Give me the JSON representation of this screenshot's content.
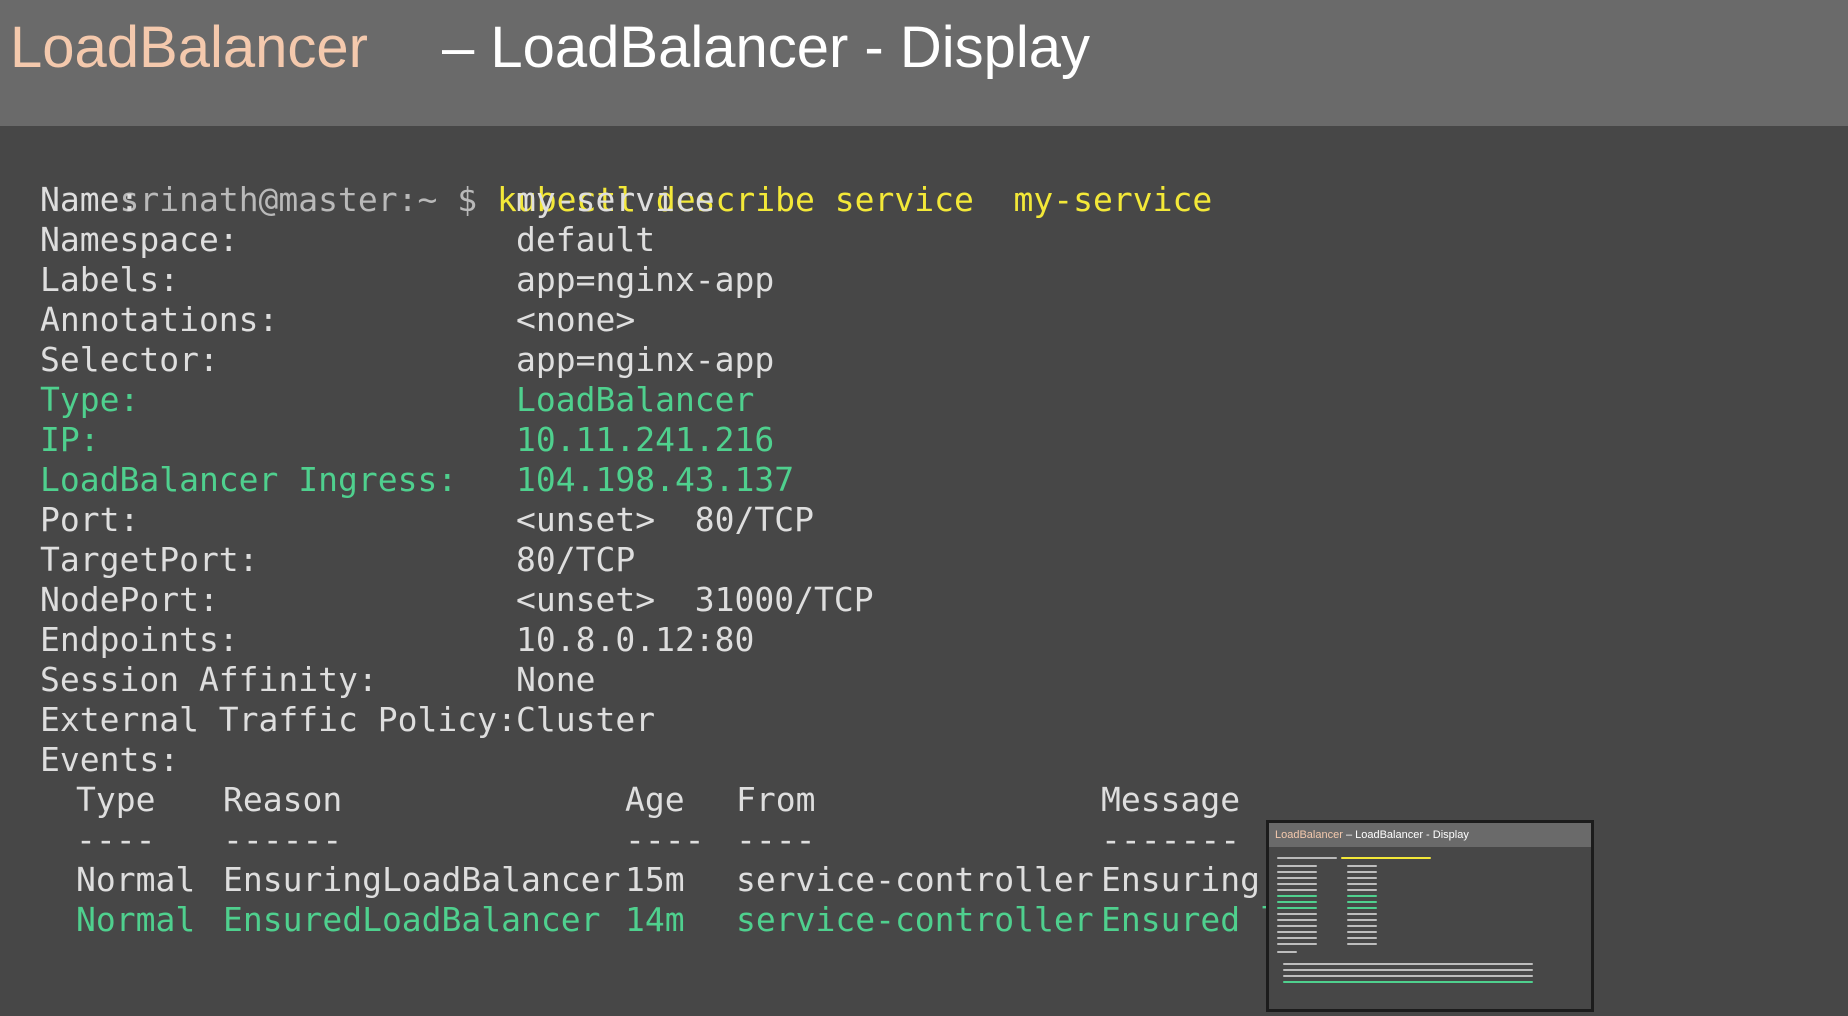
{
  "title": {
    "left": "LoadBalancer",
    "right": "– LoadBalancer - Display"
  },
  "terminal": {
    "prompt": "srinath@master:~ $",
    "command": "kubectl describe service  my-service",
    "fields": [
      {
        "key": "Name:",
        "value": "my-service",
        "highlight": false
      },
      {
        "key": "Namespace:",
        "value": "default",
        "highlight": false
      },
      {
        "key": "Labels:",
        "value": "app=nginx-app",
        "highlight": false
      },
      {
        "key": "Annotations:",
        "value": "<none>",
        "highlight": false
      },
      {
        "key": "Selector:",
        "value": "app=nginx-app",
        "highlight": false
      },
      {
        "key": "Type:",
        "value": "LoadBalancer",
        "highlight": true
      },
      {
        "key": "IP:",
        "value": "10.11.241.216",
        "highlight": true
      },
      {
        "key": "LoadBalancer Ingress:",
        "value": "104.198.43.137",
        "highlight": true
      },
      {
        "key": "Port:",
        "value": "<unset>  80/TCP",
        "highlight": false
      },
      {
        "key": "TargetPort:",
        "value": "80/TCP",
        "highlight": false
      },
      {
        "key": "NodePort:",
        "value": "<unset>  31000/TCP",
        "highlight": false
      },
      {
        "key": "Endpoints:",
        "value": "10.8.0.12:80",
        "highlight": false
      },
      {
        "key": "Session Affinity:",
        "value": "None",
        "highlight": false
      },
      {
        "key": "External Traffic Policy:",
        "value": "Cluster",
        "highlight": false
      }
    ],
    "events_label": "Events:",
    "events_table": {
      "headers": [
        "Type",
        "Reason",
        "Age",
        "From",
        "Message"
      ],
      "separators": [
        "----",
        "------",
        "----",
        "----",
        "-------"
      ],
      "rows": [
        {
          "cells": [
            "Normal",
            "EnsuringLoadBalancer",
            "15m",
            "service-controller",
            "Ensuring"
          ],
          "highlight": false
        },
        {
          "cells": [
            "Normal",
            "EnsuredLoadBalancer",
            "14m",
            "service-controller",
            "Ensured l"
          ],
          "highlight": true
        }
      ]
    }
  },
  "thumbnail": {
    "title_left": "LoadBalancer",
    "title_right": " – LoadBalancer - Display"
  },
  "colors": {
    "background": "#474747",
    "title_bar": "#6a6a6a",
    "title_accent": "#f4c9ad",
    "command": "#f3e838",
    "highlight_green": "#4fd08e",
    "text": "#dedede"
  }
}
